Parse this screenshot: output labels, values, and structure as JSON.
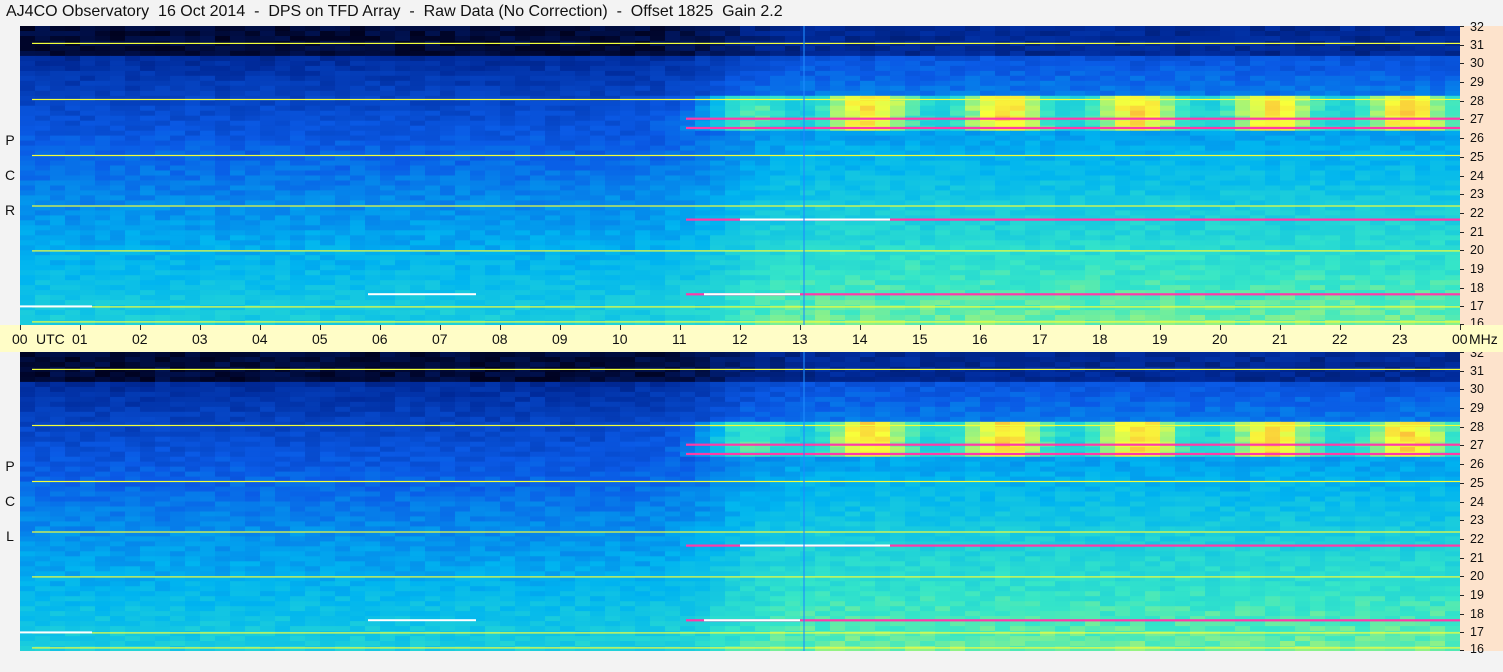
{
  "title": "AJ4CO Observatory  16 Oct 2014  -  DPS on TFD Array  -  Raw Data (No Correction)  -  Offset 1825  Gain 2.2",
  "time_axis": {
    "labels": [
      "00",
      "01",
      "02",
      "03",
      "04",
      "05",
      "06",
      "07",
      "08",
      "09",
      "10",
      "11",
      "12",
      "13",
      "14",
      "15",
      "16",
      "17",
      "18",
      "19",
      "20",
      "21",
      "22",
      "23",
      "00"
    ],
    "start_unit": "UTC",
    "end_unit": "MHz"
  },
  "freq_axis": {
    "labels": [
      "32",
      "31",
      "30",
      "29",
      "28",
      "27",
      "26",
      "25",
      "24",
      "23",
      "22",
      "21",
      "20",
      "19",
      "18",
      "17",
      "16"
    ]
  },
  "panels": [
    {
      "id": "rcp",
      "pol_letters": [
        "P",
        "C",
        "R"
      ]
    },
    {
      "id": "lcp",
      "pol_letters": [
        "P",
        "C",
        "L"
      ]
    }
  ],
  "chart_data": {
    "type": "heatmap",
    "title": "AJ4CO Observatory  16 Oct 2014  -  DPS on TFD Array  -  Raw Data (No Correction)  -  Offset 1825  Gain 2.2",
    "x_unit": "UTC",
    "y_unit": "MHz",
    "x_range": [
      "00",
      "00"
    ],
    "y_range": [
      16,
      32
    ],
    "panels": [
      "RCP",
      "LCP"
    ],
    "colormap": [
      "#00001a",
      "#002a9a",
      "#0a5ae6",
      "#00b4f0",
      "#35e6c8",
      "#f8ff3a",
      "#ff6a3a",
      "#ff2aaa",
      "#ffffff"
    ],
    "interference_bands_mhz": [
      31.1,
      28.1,
      27.1,
      26.6,
      25.1,
      22.4,
      21.7,
      20.0,
      17.7,
      17.0,
      16.2
    ],
    "daylight_onset_hour": 11.7
  }
}
